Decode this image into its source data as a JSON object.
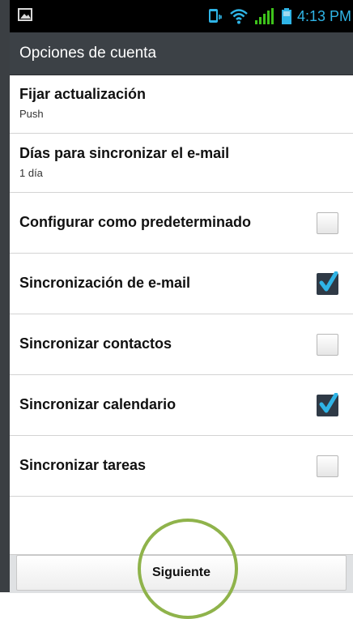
{
  "status_bar": {
    "time": "4:13 PM",
    "accent": "#2fb4e6"
  },
  "title_bar": {
    "title": "Opciones de cuenta"
  },
  "settings": [
    {
      "title": "Fijar actualización",
      "subtitle": "Push"
    },
    {
      "title": "Días para sincronizar el e-mail",
      "subtitle": "1 día"
    },
    {
      "title": "Configurar como predeterminado",
      "checked": false
    },
    {
      "title": "Sincronización de e-mail",
      "checked": true
    },
    {
      "title": "Sincronizar contactos",
      "checked": false
    },
    {
      "title": "Sincronizar calendario",
      "checked": true
    },
    {
      "title": "Sincronizar tareas",
      "checked": false
    }
  ],
  "footer": {
    "next_label": "Siguiente"
  },
  "colors": {
    "titlebar": "#3c4146",
    "highlight": "#8fb34b",
    "check_on": "#2f3a46",
    "check_mark": "#2fb4e6"
  }
}
